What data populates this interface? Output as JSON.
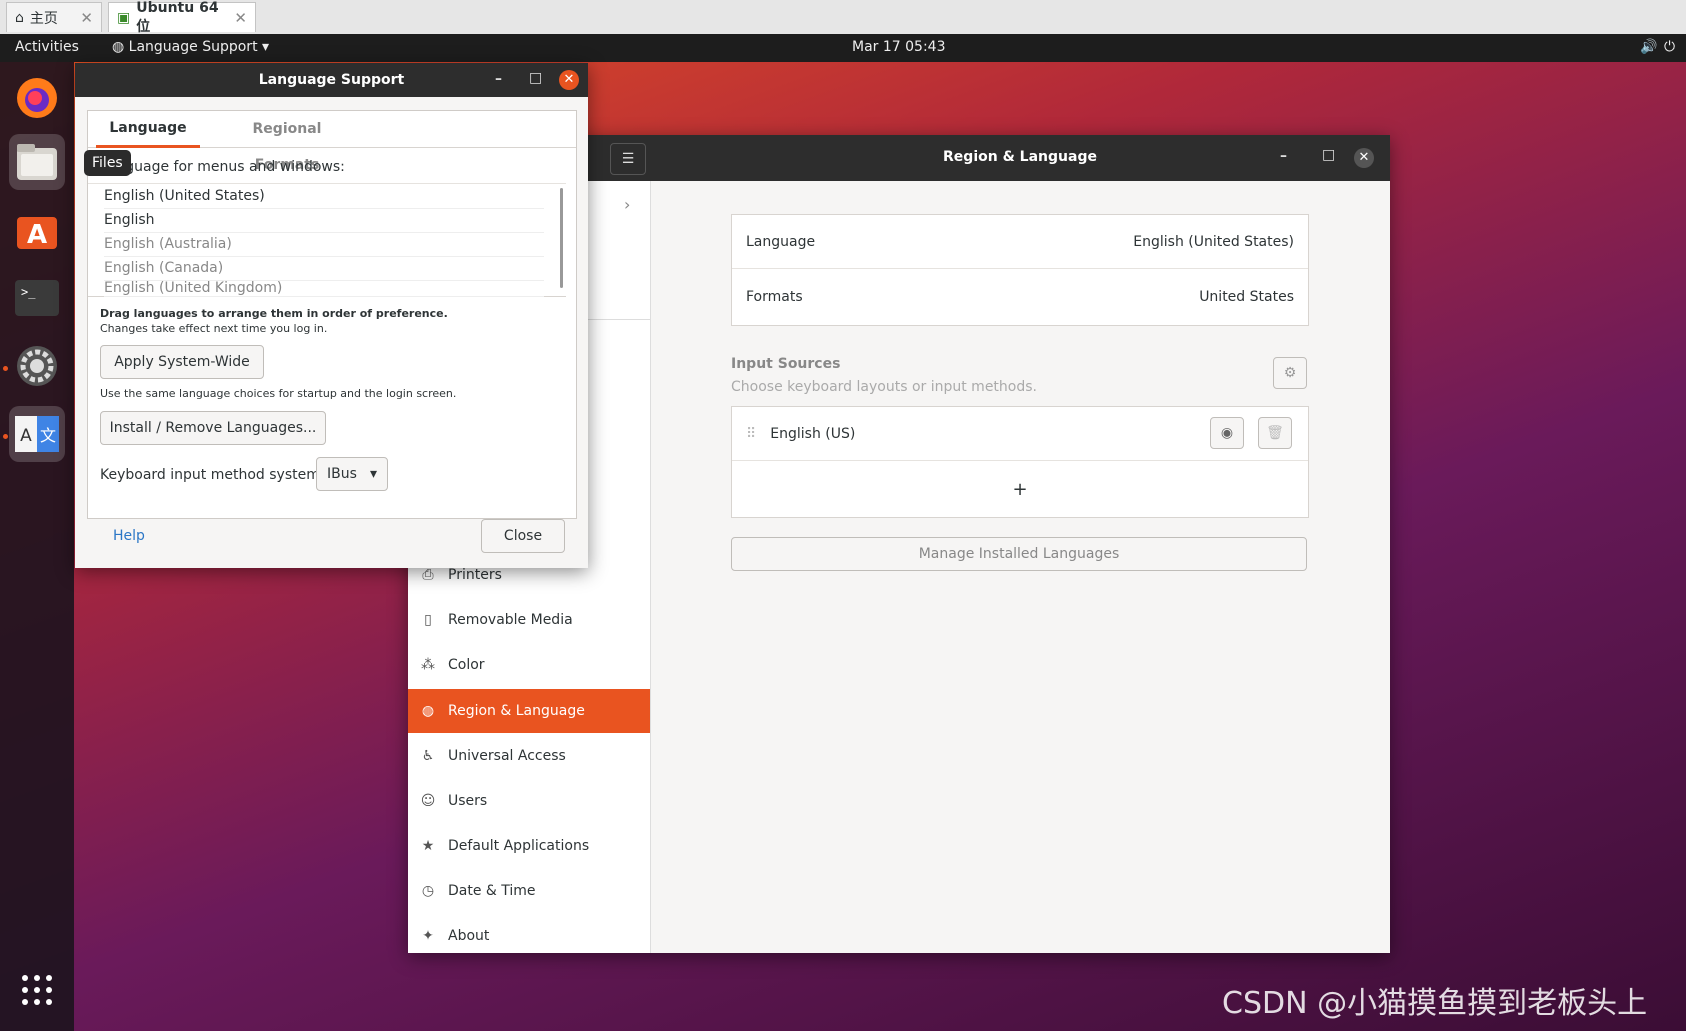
{
  "host_tabs": [
    {
      "label": "主页"
    },
    {
      "label": "Ubuntu 64 位"
    }
  ],
  "topbar": {
    "activities": "Activities",
    "app_menu": "Language Support",
    "clock": "Mar 17  05:43"
  },
  "dock": {
    "tooltip": "Files"
  },
  "lang_support": {
    "title": "Language Support",
    "tabs": [
      "Language",
      "Regional Formats"
    ],
    "heading": "Language for menus and windows:",
    "languages": [
      {
        "label": "English (United States)",
        "active": true
      },
      {
        "label": "English",
        "active": true
      },
      {
        "label": "English (Australia)",
        "active": false
      },
      {
        "label": "English (Canada)",
        "active": false
      },
      {
        "label": "English (United Kingdom)",
        "active": false
      }
    ],
    "drag_hint": "Drag languages to arrange them in order of preference.",
    "drag_hint_sub": "Changes take effect next time you log in.",
    "apply_button": "Apply System-Wide",
    "apply_hint": "Use the same language choices for startup and the login screen.",
    "install_button": "Install / Remove Languages...",
    "input_method_label": "Keyboard input method system:",
    "input_method_value": "IBus",
    "help": "Help",
    "close": "Close"
  },
  "settings": {
    "title": "Region & Language",
    "sidebar": [
      {
        "label": "Printers",
        "icon": "printer-icon"
      },
      {
        "label": "Removable Media",
        "icon": "removable-media-icon"
      },
      {
        "label": "Color",
        "icon": "color-icon"
      },
      {
        "label": "Region & Language",
        "icon": "globe-icon",
        "selected": true
      },
      {
        "label": "Universal Access",
        "icon": "accessibility-icon"
      },
      {
        "label": "Users",
        "icon": "users-icon"
      },
      {
        "label": "Default Applications",
        "icon": "star-icon"
      },
      {
        "label": "Date & Time",
        "icon": "clock-icon"
      },
      {
        "label": "About",
        "icon": "sparkle-icon"
      }
    ],
    "language_label": "Language",
    "language_value": "English (United States)",
    "formats_label": "Formats",
    "formats_value": "United States",
    "input_sources_title": "Input Sources",
    "input_sources_sub": "Choose keyboard layouts or input methods.",
    "input_source": "English (US)",
    "add_symbol": "+",
    "manage_button": "Manage Installed Languages"
  },
  "watermark": "CSDN @小猫摸鱼摸到老板头上",
  "colors": {
    "accent": "#e95420",
    "titlebar": "#2d2d2d",
    "topbar": "#1d1d1d"
  }
}
